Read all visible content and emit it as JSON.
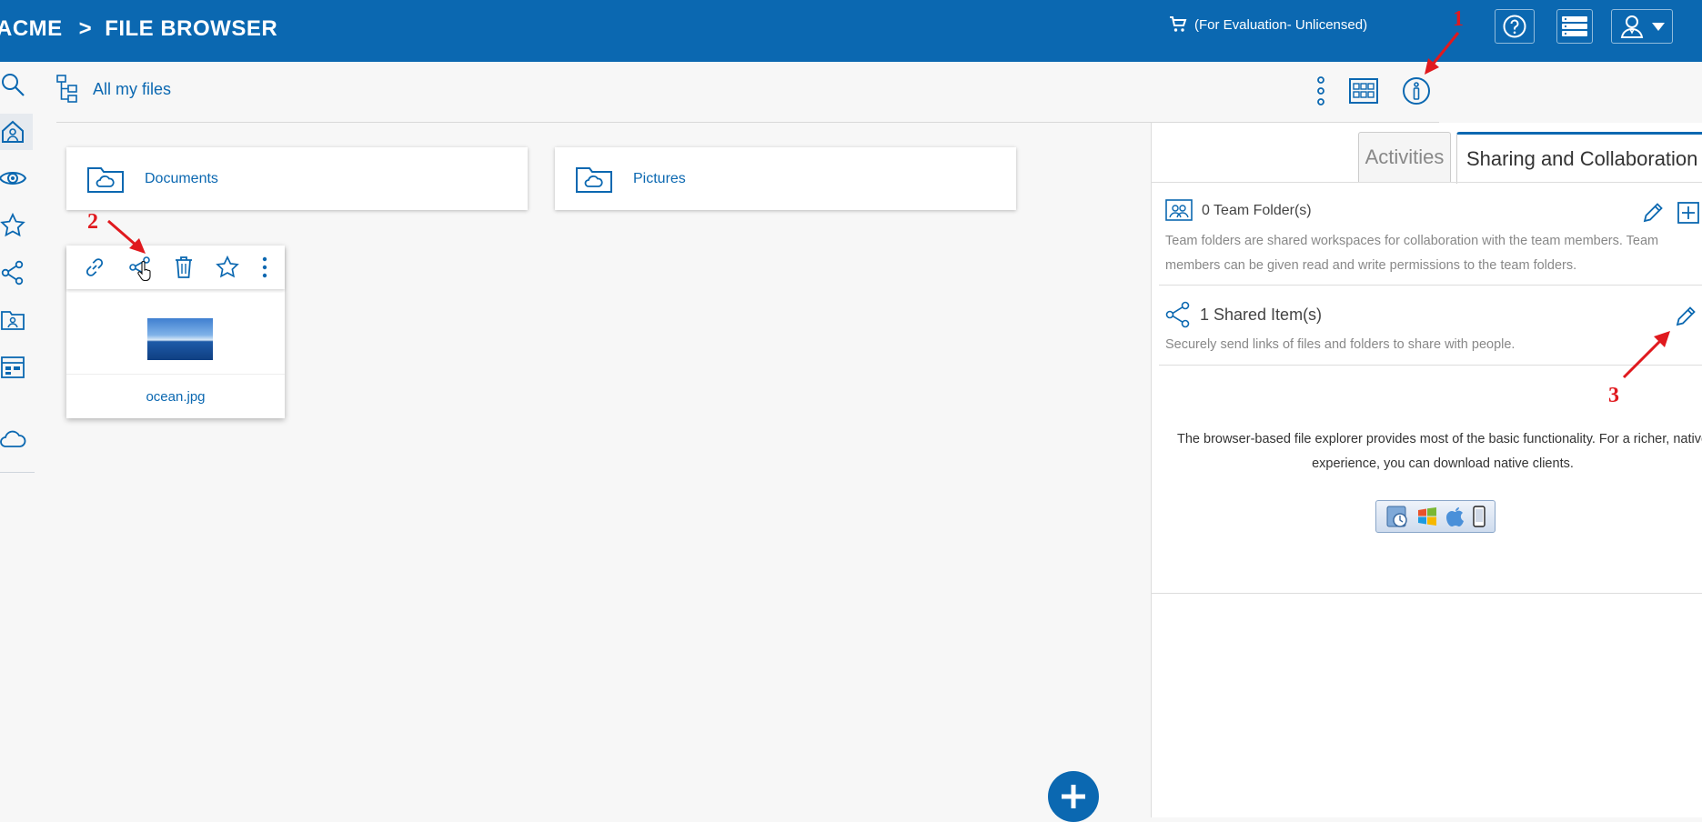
{
  "topbar": {
    "brand": "ACME",
    "separator": ">",
    "section": "FILE BROWSER",
    "license": "(For Evaluation- Unlicensed)",
    "icons": [
      "cart-icon",
      "help-icon",
      "server-icon",
      "user-menu-icon",
      "chevron-down-icon"
    ]
  },
  "rail": {
    "items": [
      "search-icon",
      "home-icon",
      "eye-icon",
      "star-icon",
      "share-icon",
      "team-folder-icon",
      "dashboard-icon",
      "cloud-icon"
    ]
  },
  "subheader": {
    "breadcrumb": "All my files",
    "icons": [
      "tree-icon",
      "more-vertical-icon",
      "grid-view-icon",
      "info-icon"
    ]
  },
  "folders": [
    {
      "name": "Documents",
      "icon": "cloud-folder-icon"
    },
    {
      "name": "Pictures",
      "icon": "cloud-folder-icon"
    }
  ],
  "file": {
    "name": "ocean.jpg",
    "toolbar_icons": [
      "link-icon",
      "share-icon",
      "trash-icon",
      "star-icon",
      "more-vertical-icon"
    ]
  },
  "panel": {
    "tabs": [
      "Activities",
      "Sharing and Collaboration"
    ],
    "team_folders": {
      "title": "0 Team Folder(s)",
      "description_line1": "Team folders are shared workspaces for collaboration with the team members. Team",
      "description_line2": "members can be given read and write permissions to the team folders."
    },
    "shared_items": {
      "title": "1 Shared Item(s)",
      "description": "Securely send links of files and folders to share with people."
    },
    "info_line1": "The browser-based file explorer provides most of the basic functionality. For a richer, native",
    "info_line2": "experience, you can download native clients."
  },
  "annotations": [
    "1",
    "2",
    "3"
  ],
  "colors": {
    "brand": "#0b68b1",
    "annotation": "#e0191e"
  }
}
